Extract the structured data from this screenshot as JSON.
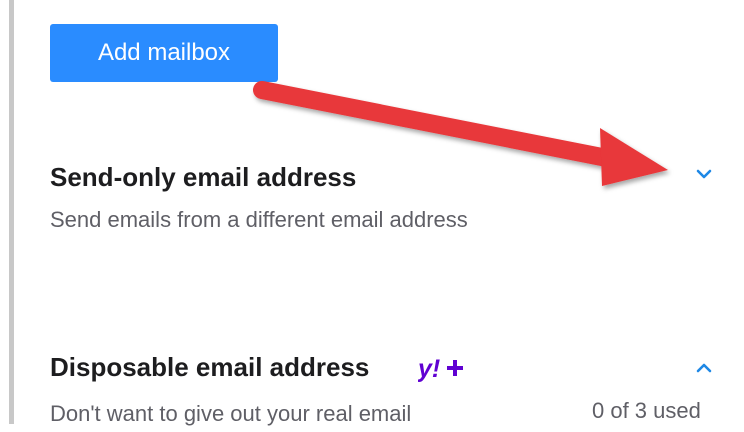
{
  "add_mailbox": {
    "label": "Add mailbox"
  },
  "send_only": {
    "title": "Send-only email address",
    "description": "Send emails from a different email address",
    "chevron_icon": "chevron-down-icon"
  },
  "disposable": {
    "title": "Disposable email address",
    "badge_icon": "yahoo-plus-icon",
    "badge_text": "y!+",
    "description": "Don't want to give out your real email",
    "usage": "0 of 3 used",
    "chevron_icon": "chevron-up-icon"
  },
  "colors": {
    "accent": "#2a8cff",
    "chevron": "#1e88e5",
    "badge": "#6001d2",
    "annotation_arrow": "#e8373a"
  }
}
